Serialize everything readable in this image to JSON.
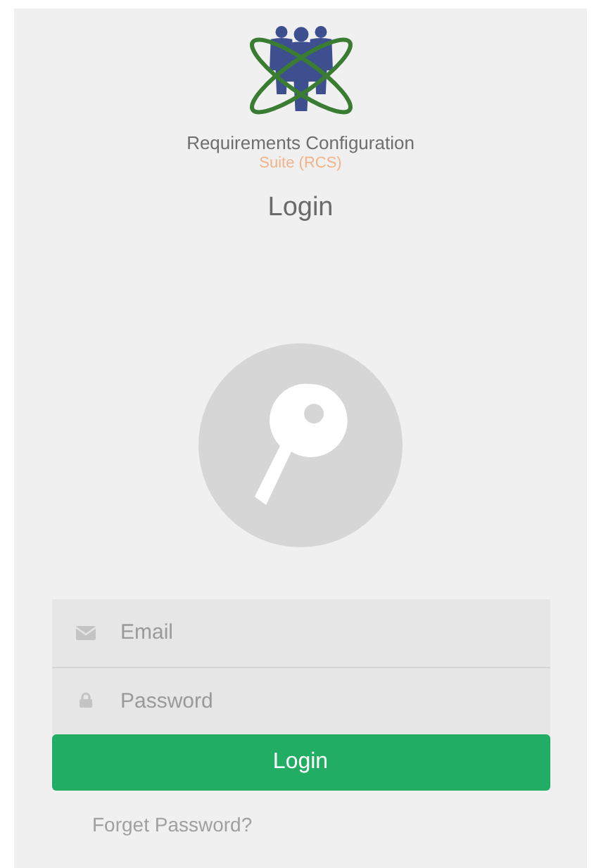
{
  "app_name": "Requirements Configuration",
  "app_subtitle": "Suite (RCS)",
  "heading": "Login",
  "fields": [
    {
      "kind": "email",
      "placeholder": "Email"
    },
    {
      "kind": "password",
      "placeholder": "Password"
    }
  ],
  "login_button": "Login",
  "forgot_link": "Forget Password?"
}
